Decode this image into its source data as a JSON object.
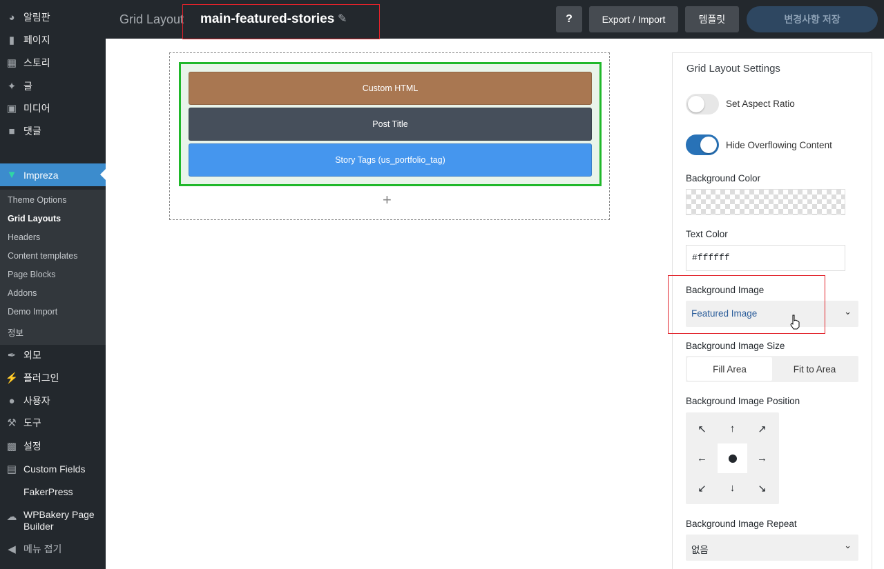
{
  "sidebar": {
    "top_items": [
      {
        "label": "알림판",
        "icon": "dashboard-icon"
      },
      {
        "label": "페이지",
        "icon": "pages-icon"
      },
      {
        "label": "스토리",
        "icon": "stories-icon"
      },
      {
        "label": "글",
        "icon": "pin-icon"
      },
      {
        "label": "미디어",
        "icon": "media-icon"
      },
      {
        "label": "댓글",
        "icon": "comments-icon"
      }
    ],
    "active": {
      "label": "Impreza",
      "icon": "impreza-icon"
    },
    "sub_items": [
      "Theme Options",
      "Grid Layouts",
      "Headers",
      "Content templates",
      "Page Blocks",
      "Addons",
      "Demo Import",
      "정보"
    ],
    "bottom_items": [
      {
        "label": "외모",
        "icon": "brush-icon"
      },
      {
        "label": "플러그인",
        "icon": "plugin-icon"
      },
      {
        "label": "사용자",
        "icon": "users-icon"
      },
      {
        "label": "도구",
        "icon": "tools-icon"
      },
      {
        "label": "설정",
        "icon": "settings-icon"
      },
      {
        "label": "Custom Fields",
        "icon": "table-icon"
      },
      {
        "label": "FakerPress",
        "icon": ""
      },
      {
        "label": "WPBakery Page Builder",
        "icon": "cloud-icon"
      },
      {
        "label": "메뉴 접기",
        "icon": "collapse-icon"
      }
    ]
  },
  "topbar": {
    "section_label": "Grid Layout",
    "layout_name": "main-featured-stories",
    "help_label": "?",
    "export_label": "Export / Import",
    "templates_label": "템플릿",
    "save_label": "변경사항 저장"
  },
  "canvas": {
    "elements": [
      {
        "label": "Custom HTML",
        "color": "#a97751"
      },
      {
        "label": "Post Title",
        "color": "#464f5b"
      },
      {
        "label": "Story Tags (us_portfolio_tag)",
        "color": "#4596ee"
      }
    ],
    "add_label": "+"
  },
  "panel": {
    "title": "Grid Layout Settings",
    "aspect_ratio_label": "Set Aspect Ratio",
    "aspect_ratio_on": false,
    "hide_overflow_label": "Hide Overflowing Content",
    "hide_overflow_on": true,
    "bg_color_label": "Background Color",
    "text_color_label": "Text Color",
    "text_color_value": "#ffffff",
    "bg_image_label": "Background Image",
    "bg_image_value": "Featured Image",
    "bg_size_label": "Background Image Size",
    "bg_size_options": [
      "Fill Area",
      "Fit to Area"
    ],
    "bg_position_label": "Background Image Position",
    "bg_repeat_label": "Background Image Repeat",
    "bg_repeat_value": "없음"
  }
}
